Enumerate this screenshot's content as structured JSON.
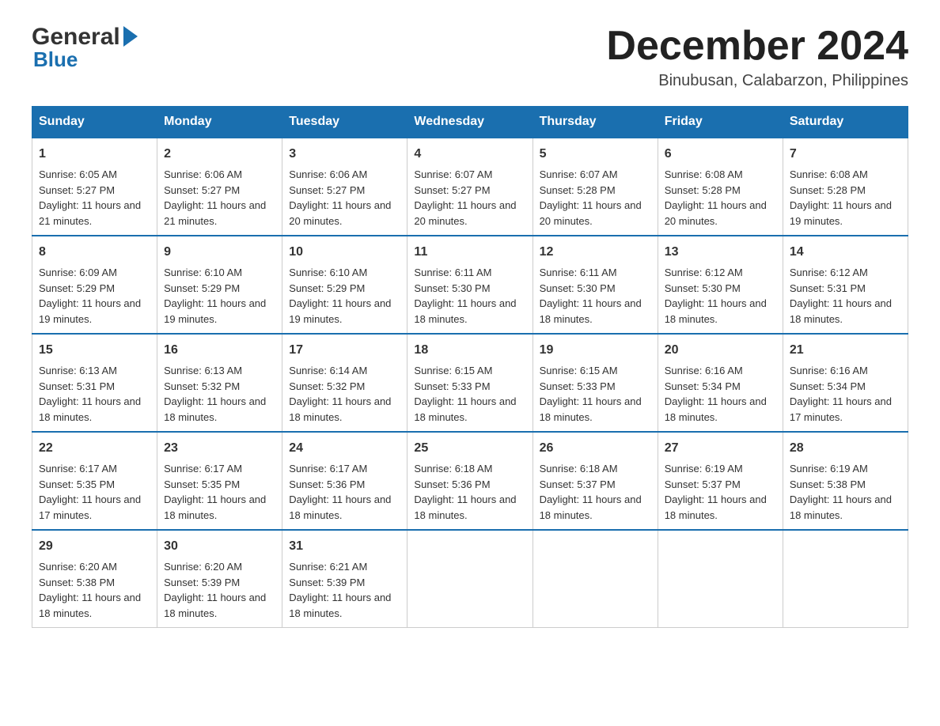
{
  "logo": {
    "general": "General",
    "blue": "Blue",
    "triangle": "▶"
  },
  "title": "December 2024",
  "subtitle": "Binubusan, Calabarzon, Philippines",
  "days": [
    "Sunday",
    "Monday",
    "Tuesday",
    "Wednesday",
    "Thursday",
    "Friday",
    "Saturday"
  ],
  "weeks": [
    [
      {
        "num": "1",
        "sunrise": "6:05 AM",
        "sunset": "5:27 PM",
        "daylight": "11 hours and 21 minutes."
      },
      {
        "num": "2",
        "sunrise": "6:06 AM",
        "sunset": "5:27 PM",
        "daylight": "11 hours and 21 minutes."
      },
      {
        "num": "3",
        "sunrise": "6:06 AM",
        "sunset": "5:27 PM",
        "daylight": "11 hours and 20 minutes."
      },
      {
        "num": "4",
        "sunrise": "6:07 AM",
        "sunset": "5:27 PM",
        "daylight": "11 hours and 20 minutes."
      },
      {
        "num": "5",
        "sunrise": "6:07 AM",
        "sunset": "5:28 PM",
        "daylight": "11 hours and 20 minutes."
      },
      {
        "num": "6",
        "sunrise": "6:08 AM",
        "sunset": "5:28 PM",
        "daylight": "11 hours and 20 minutes."
      },
      {
        "num": "7",
        "sunrise": "6:08 AM",
        "sunset": "5:28 PM",
        "daylight": "11 hours and 19 minutes."
      }
    ],
    [
      {
        "num": "8",
        "sunrise": "6:09 AM",
        "sunset": "5:29 PM",
        "daylight": "11 hours and 19 minutes."
      },
      {
        "num": "9",
        "sunrise": "6:10 AM",
        "sunset": "5:29 PM",
        "daylight": "11 hours and 19 minutes."
      },
      {
        "num": "10",
        "sunrise": "6:10 AM",
        "sunset": "5:29 PM",
        "daylight": "11 hours and 19 minutes."
      },
      {
        "num": "11",
        "sunrise": "6:11 AM",
        "sunset": "5:30 PM",
        "daylight": "11 hours and 18 minutes."
      },
      {
        "num": "12",
        "sunrise": "6:11 AM",
        "sunset": "5:30 PM",
        "daylight": "11 hours and 18 minutes."
      },
      {
        "num": "13",
        "sunrise": "6:12 AM",
        "sunset": "5:30 PM",
        "daylight": "11 hours and 18 minutes."
      },
      {
        "num": "14",
        "sunrise": "6:12 AM",
        "sunset": "5:31 PM",
        "daylight": "11 hours and 18 minutes."
      }
    ],
    [
      {
        "num": "15",
        "sunrise": "6:13 AM",
        "sunset": "5:31 PM",
        "daylight": "11 hours and 18 minutes."
      },
      {
        "num": "16",
        "sunrise": "6:13 AM",
        "sunset": "5:32 PM",
        "daylight": "11 hours and 18 minutes."
      },
      {
        "num": "17",
        "sunrise": "6:14 AM",
        "sunset": "5:32 PM",
        "daylight": "11 hours and 18 minutes."
      },
      {
        "num": "18",
        "sunrise": "6:15 AM",
        "sunset": "5:33 PM",
        "daylight": "11 hours and 18 minutes."
      },
      {
        "num": "19",
        "sunrise": "6:15 AM",
        "sunset": "5:33 PM",
        "daylight": "11 hours and 18 minutes."
      },
      {
        "num": "20",
        "sunrise": "6:16 AM",
        "sunset": "5:34 PM",
        "daylight": "11 hours and 18 minutes."
      },
      {
        "num": "21",
        "sunrise": "6:16 AM",
        "sunset": "5:34 PM",
        "daylight": "11 hours and 17 minutes."
      }
    ],
    [
      {
        "num": "22",
        "sunrise": "6:17 AM",
        "sunset": "5:35 PM",
        "daylight": "11 hours and 17 minutes."
      },
      {
        "num": "23",
        "sunrise": "6:17 AM",
        "sunset": "5:35 PM",
        "daylight": "11 hours and 18 minutes."
      },
      {
        "num": "24",
        "sunrise": "6:17 AM",
        "sunset": "5:36 PM",
        "daylight": "11 hours and 18 minutes."
      },
      {
        "num": "25",
        "sunrise": "6:18 AM",
        "sunset": "5:36 PM",
        "daylight": "11 hours and 18 minutes."
      },
      {
        "num": "26",
        "sunrise": "6:18 AM",
        "sunset": "5:37 PM",
        "daylight": "11 hours and 18 minutes."
      },
      {
        "num": "27",
        "sunrise": "6:19 AM",
        "sunset": "5:37 PM",
        "daylight": "11 hours and 18 minutes."
      },
      {
        "num": "28",
        "sunrise": "6:19 AM",
        "sunset": "5:38 PM",
        "daylight": "11 hours and 18 minutes."
      }
    ],
    [
      {
        "num": "29",
        "sunrise": "6:20 AM",
        "sunset": "5:38 PM",
        "daylight": "11 hours and 18 minutes."
      },
      {
        "num": "30",
        "sunrise": "6:20 AM",
        "sunset": "5:39 PM",
        "daylight": "11 hours and 18 minutes."
      },
      {
        "num": "31",
        "sunrise": "6:21 AM",
        "sunset": "5:39 PM",
        "daylight": "11 hours and 18 minutes."
      },
      null,
      null,
      null,
      null
    ]
  ],
  "labels": {
    "sunrise": "Sunrise:",
    "sunset": "Sunset:",
    "daylight": "Daylight:"
  }
}
